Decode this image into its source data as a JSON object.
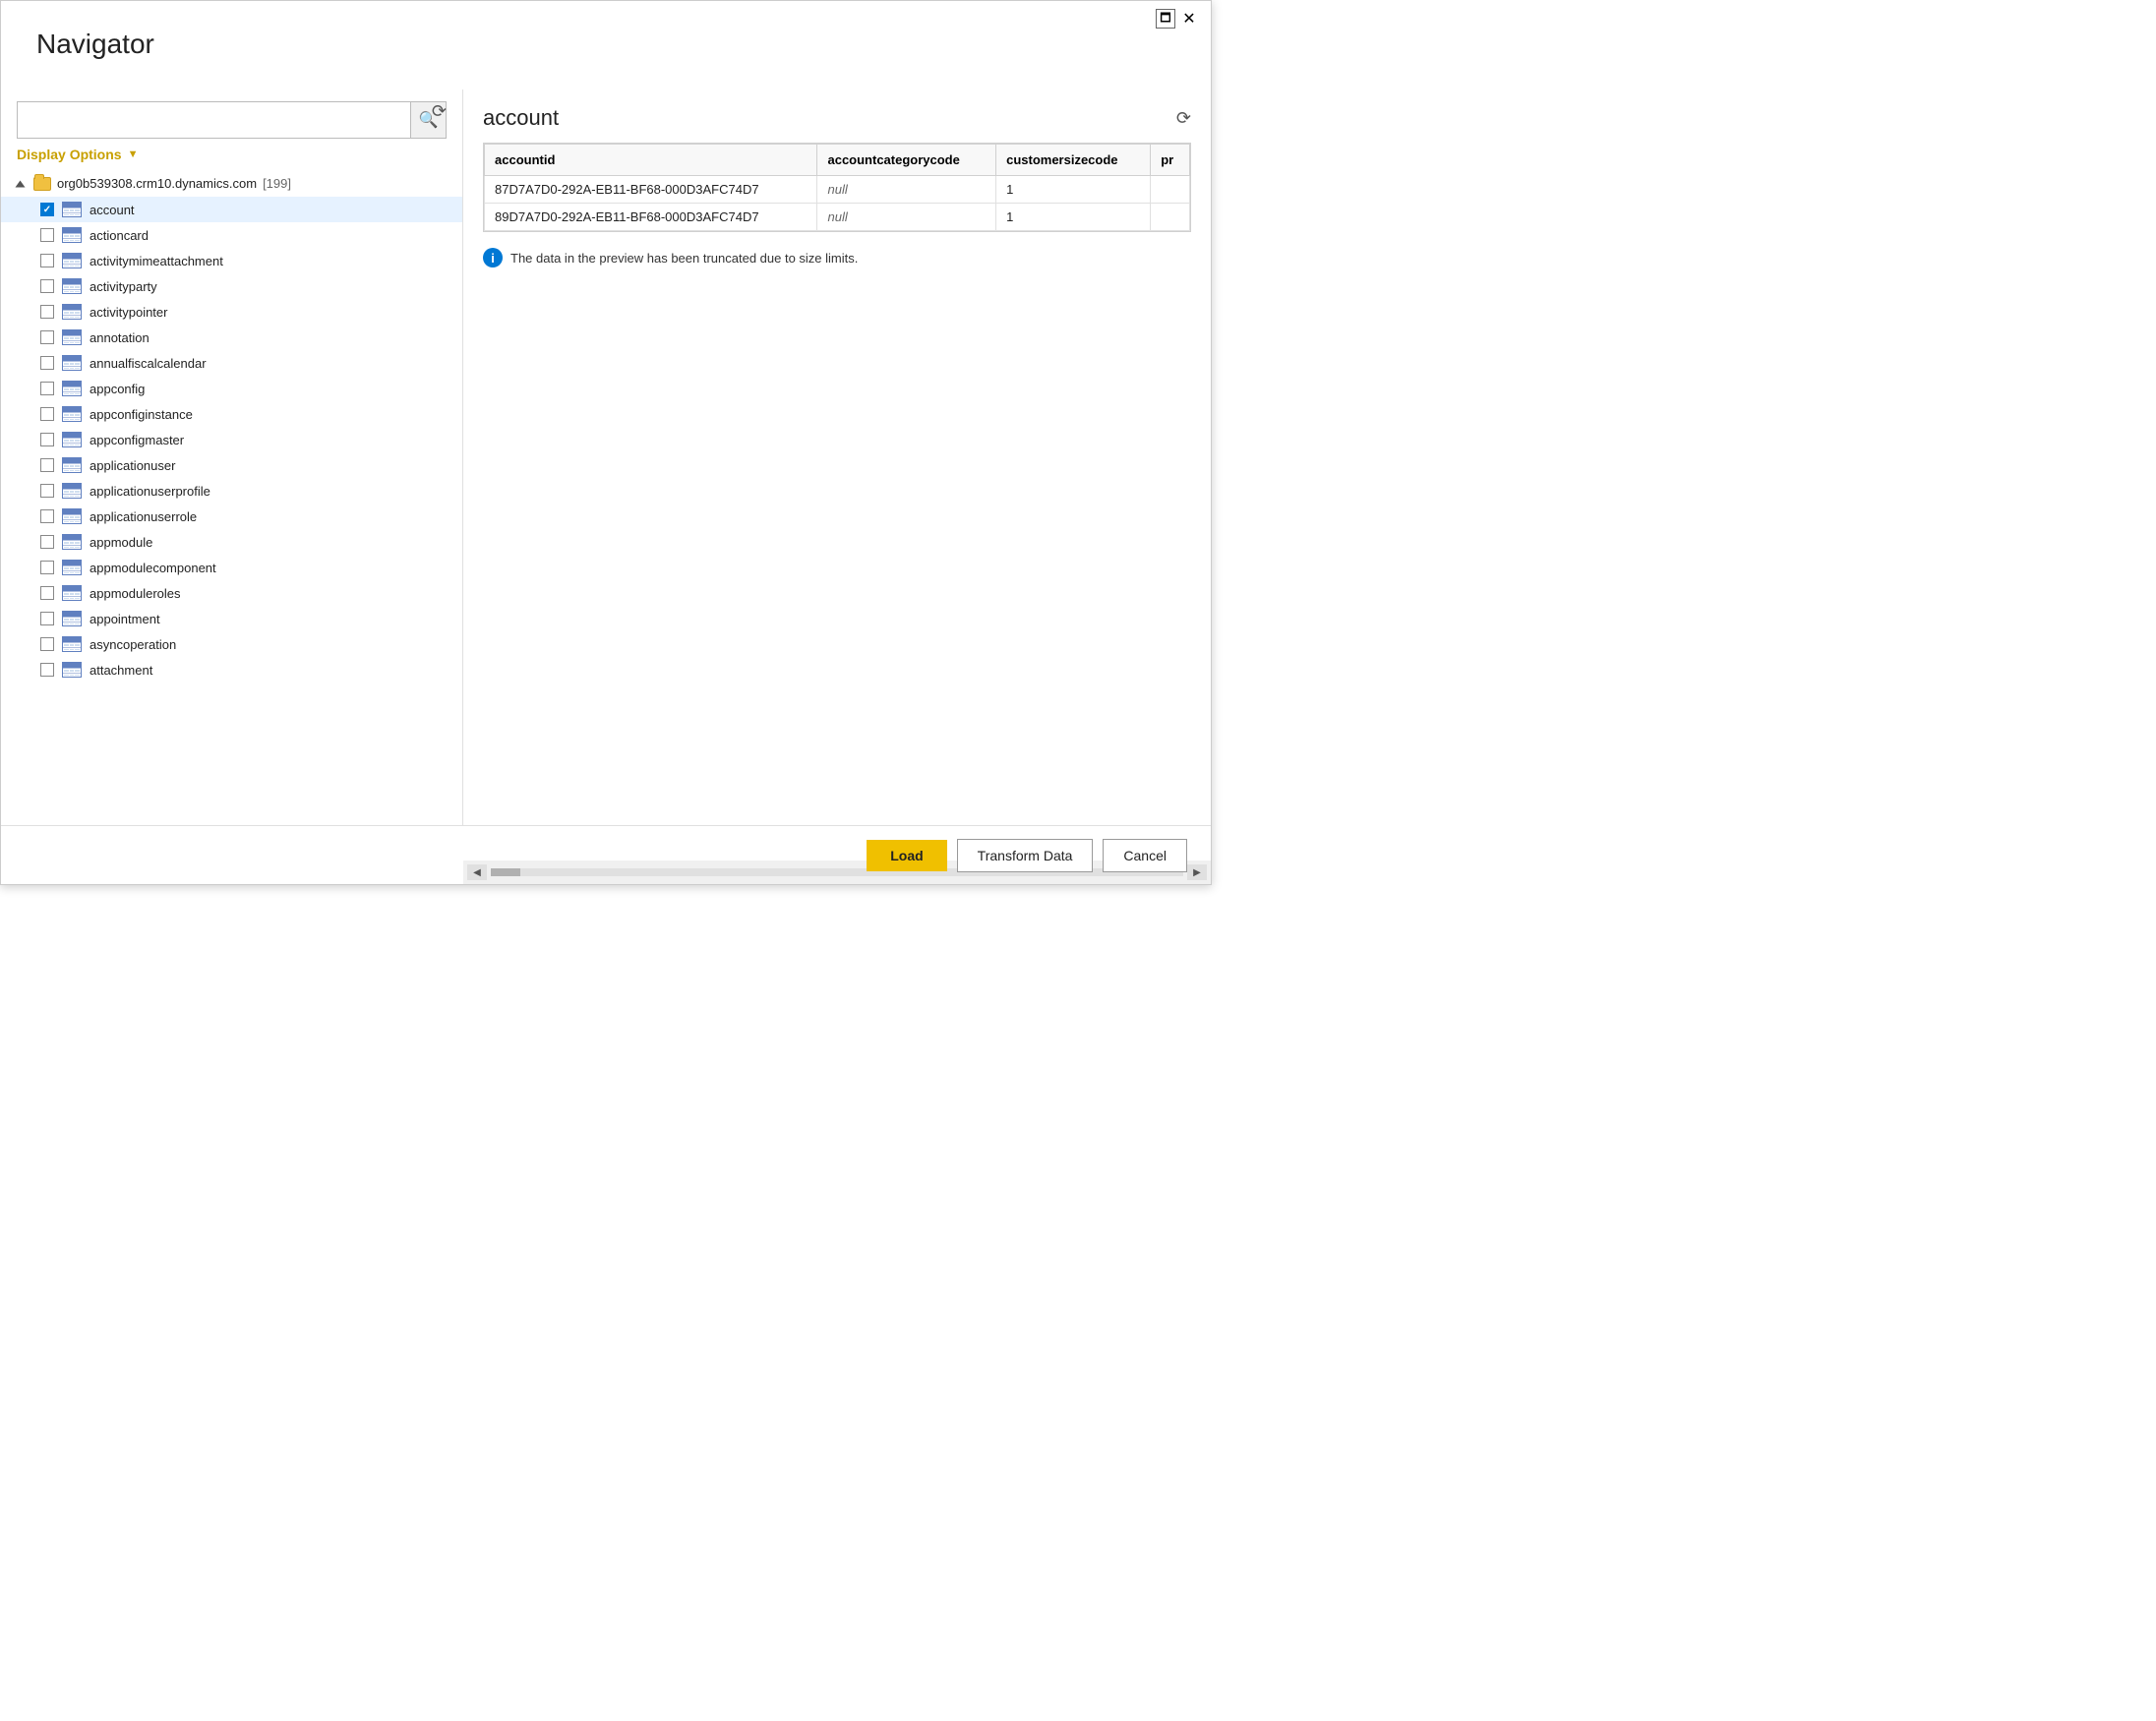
{
  "window": {
    "title": "Navigator",
    "minimize_label": "🗖",
    "close_label": "✕"
  },
  "search": {
    "placeholder": ""
  },
  "display_options": {
    "label": "Display Options",
    "chevron": "▼"
  },
  "tree": {
    "root": {
      "label": "org0b539308.crm10.dynamics.com",
      "count": "[199]"
    },
    "items": [
      {
        "label": "account",
        "checked": true
      },
      {
        "label": "actioncard",
        "checked": false
      },
      {
        "label": "activitymimeattachment",
        "checked": false
      },
      {
        "label": "activityparty",
        "checked": false
      },
      {
        "label": "activitypointer",
        "checked": false
      },
      {
        "label": "annotation",
        "checked": false
      },
      {
        "label": "annualfiscalcalendar",
        "checked": false
      },
      {
        "label": "appconfig",
        "checked": false
      },
      {
        "label": "appconfiginstance",
        "checked": false
      },
      {
        "label": "appconfigmaster",
        "checked": false
      },
      {
        "label": "applicationuser",
        "checked": false
      },
      {
        "label": "applicationuserprofile",
        "checked": false
      },
      {
        "label": "applicationuserrole",
        "checked": false
      },
      {
        "label": "appmodule",
        "checked": false
      },
      {
        "label": "appmodulecomponent",
        "checked": false
      },
      {
        "label": "appmoduleroles",
        "checked": false
      },
      {
        "label": "appointment",
        "checked": false
      },
      {
        "label": "asyncoperation",
        "checked": false
      },
      {
        "label": "attachment",
        "checked": false
      }
    ]
  },
  "preview": {
    "title": "account",
    "columns": [
      "accountid",
      "accountcategorycode",
      "customersizecode",
      "pr"
    ],
    "rows": [
      {
        "accountid": "87D7A7D0-292A-EB11-BF68-000D3AFC74D7",
        "accountcategorycode": "null",
        "customersizecode": "1",
        "pr": ""
      },
      {
        "accountid": "89D7A7D0-292A-EB11-BF68-000D3AFC74D7",
        "accountcategorycode": "null",
        "customersizecode": "1",
        "pr": ""
      }
    ],
    "info_message": "The data in the preview has been truncated due to size limits."
  },
  "buttons": {
    "load": "Load",
    "transform": "Transform Data",
    "cancel": "Cancel"
  }
}
